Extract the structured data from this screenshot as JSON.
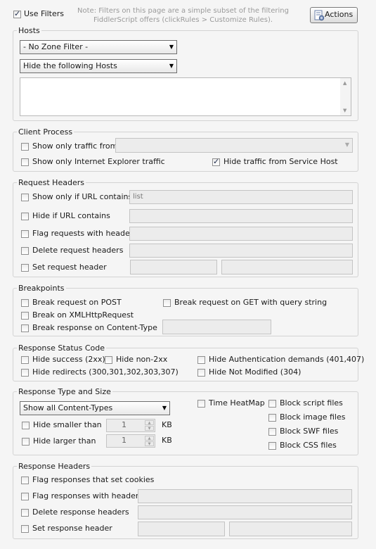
{
  "top": {
    "use_filters": "Use Filters",
    "use_filters_checked": true,
    "note_line1": "Note: Filters on this page are a simple subset of the filtering",
    "note_line2": "FiddlerScript offers (clickRules > Customize Rules).",
    "actions_label": "Actions"
  },
  "hosts": {
    "title": "Hosts",
    "zone_filter": "- No Zone Filter -",
    "hosts_mode": "Hide the following Hosts"
  },
  "client_process": {
    "title": "Client Process",
    "show_only_from": "Show only traffic from",
    "show_only_ie": "Show only Internet Explorer traffic",
    "hide_service_host": "Hide traffic from Service Host",
    "hide_service_host_checked": true
  },
  "request_headers": {
    "title": "Request Headers",
    "show_only_url": "Show only if URL contains",
    "show_only_url_value": "list",
    "hide_if_url": "Hide if URL contains",
    "flag_with_headers": "Flag requests with headers",
    "delete_headers": "Delete request headers",
    "set_header": "Set request header"
  },
  "breakpoints": {
    "title": "Breakpoints",
    "on_post": "Break request on POST",
    "on_get_query": "Break request on GET with query string",
    "on_xhr": "Break on XMLHttpRequest",
    "on_content_type": "Break response on Content-Type"
  },
  "response_status": {
    "title": "Response Status Code",
    "hide_success": "Hide success (2xx)",
    "hide_non2xx": "Hide non-2xx",
    "hide_auth": "Hide Authentication demands (401,407)",
    "hide_redirects": "Hide redirects (300,301,302,303,307)",
    "hide_not_modified": "Hide Not Modified (304)"
  },
  "response_type": {
    "title": "Response Type and Size",
    "content_types": "Show all Content-Types",
    "time_heatmap": "Time HeatMap",
    "block_script": "Block script files",
    "block_image": "Block image files",
    "block_swf": "Block SWF files",
    "block_css": "Block CSS files",
    "hide_smaller": "Hide smaller than",
    "hide_larger": "Hide larger than",
    "smaller_value": "1",
    "larger_value": "1",
    "unit": "KB"
  },
  "response_headers": {
    "title": "Response Headers",
    "flag_set_cookies": "Flag responses that set cookies",
    "flag_with_headers": "Flag responses with headers",
    "delete_headers": "Delete response headers",
    "set_header": "Set response header"
  }
}
